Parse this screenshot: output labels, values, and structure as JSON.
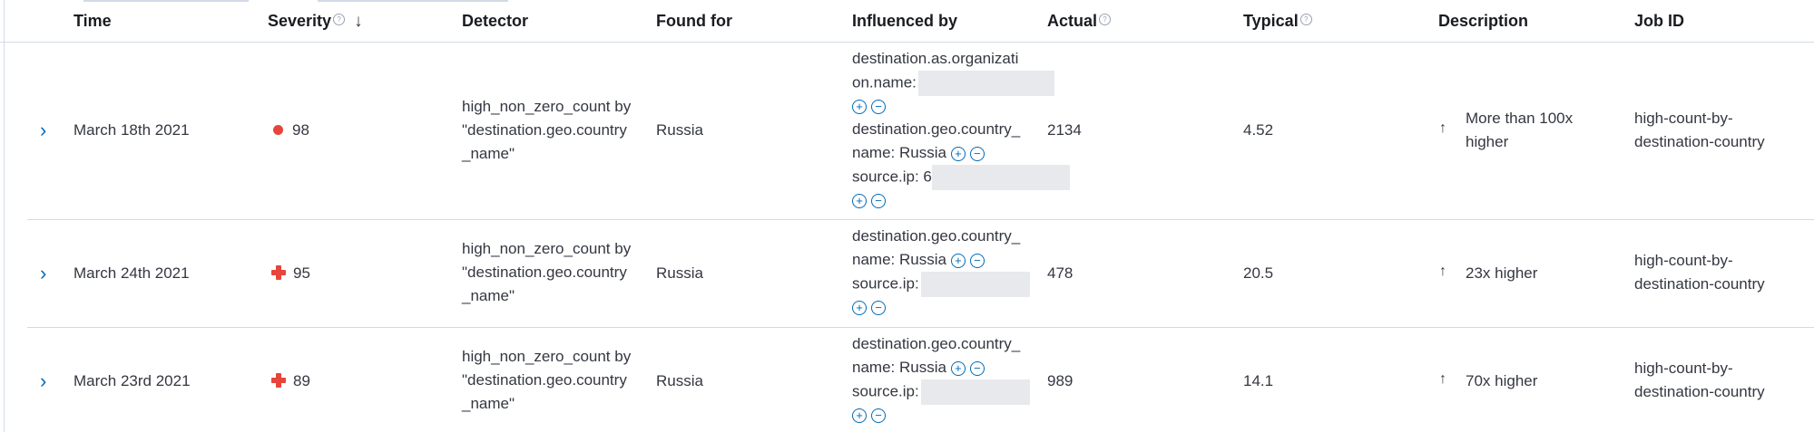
{
  "table": {
    "headers": {
      "time": "Time",
      "severity": "Severity",
      "detector": "Detector",
      "found_for": "Found for",
      "influenced_by": "Influenced by",
      "actual": "Actual",
      "typical": "Typical",
      "description": "Description",
      "job_id": "Job ID"
    },
    "rows": [
      {
        "time": "March 18th 2021",
        "severity": "98",
        "severity_marker": "circle",
        "detector_l1": "high_non_zero_count by",
        "detector_l2": "\"destination.geo.country",
        "detector_l3": "_name\"",
        "found_for": "Russia",
        "influencers": {
          "l1": "destination.as.organizati",
          "l2": "on.name:",
          "l3": "destination.geo.country_",
          "l4": "name: Russia",
          "l5": "source.ip: 6"
        },
        "actual": "2134",
        "typical": "4.52",
        "description_l1": "More than 100x",
        "description_l2": "higher",
        "job_id_l1": "high-count-by-",
        "job_id_l2": "destination-country"
      },
      {
        "time": "March 24th 2021",
        "severity": "95",
        "severity_marker": "cross",
        "detector_l1": "high_non_zero_count by",
        "detector_l2": "\"destination.geo.country",
        "detector_l3": "_name\"",
        "found_for": "Russia",
        "influencers": {
          "l1": "destination.geo.country_",
          "l2": "name: Russia",
          "l3": "source.ip:"
        },
        "actual": "478",
        "typical": "20.5",
        "description_l1": "23x higher",
        "job_id_l1": "high-count-by-",
        "job_id_l2": "destination-country"
      },
      {
        "time": "March 23rd 2021",
        "severity": "89",
        "severity_marker": "cross",
        "detector_l1": "high_non_zero_count by",
        "detector_l2": "\"destination.geo.country",
        "detector_l3": "_name\"",
        "found_for": "Russia",
        "influencers": {
          "l1": "destination.geo.country_",
          "l2": "name: Russia",
          "l3": "source.ip:"
        },
        "actual": "989",
        "typical": "14.1",
        "description_l1": "70x higher",
        "job_id_l1": "high-count-by-",
        "job_id_l2": "destination-country"
      }
    ]
  },
  "icons": {
    "expand": "chevron-right-icon",
    "sort": "arrow-down-icon",
    "info": "question-circle-icon",
    "filter_in": "plus-circle-icon",
    "filter_out": "minus-circle-icon",
    "description": "arrow-up-icon"
  },
  "colors": {
    "severity_critical": "#e7443c",
    "link": "#006bb8",
    "border": "#d3dae6",
    "text": "#343741"
  }
}
